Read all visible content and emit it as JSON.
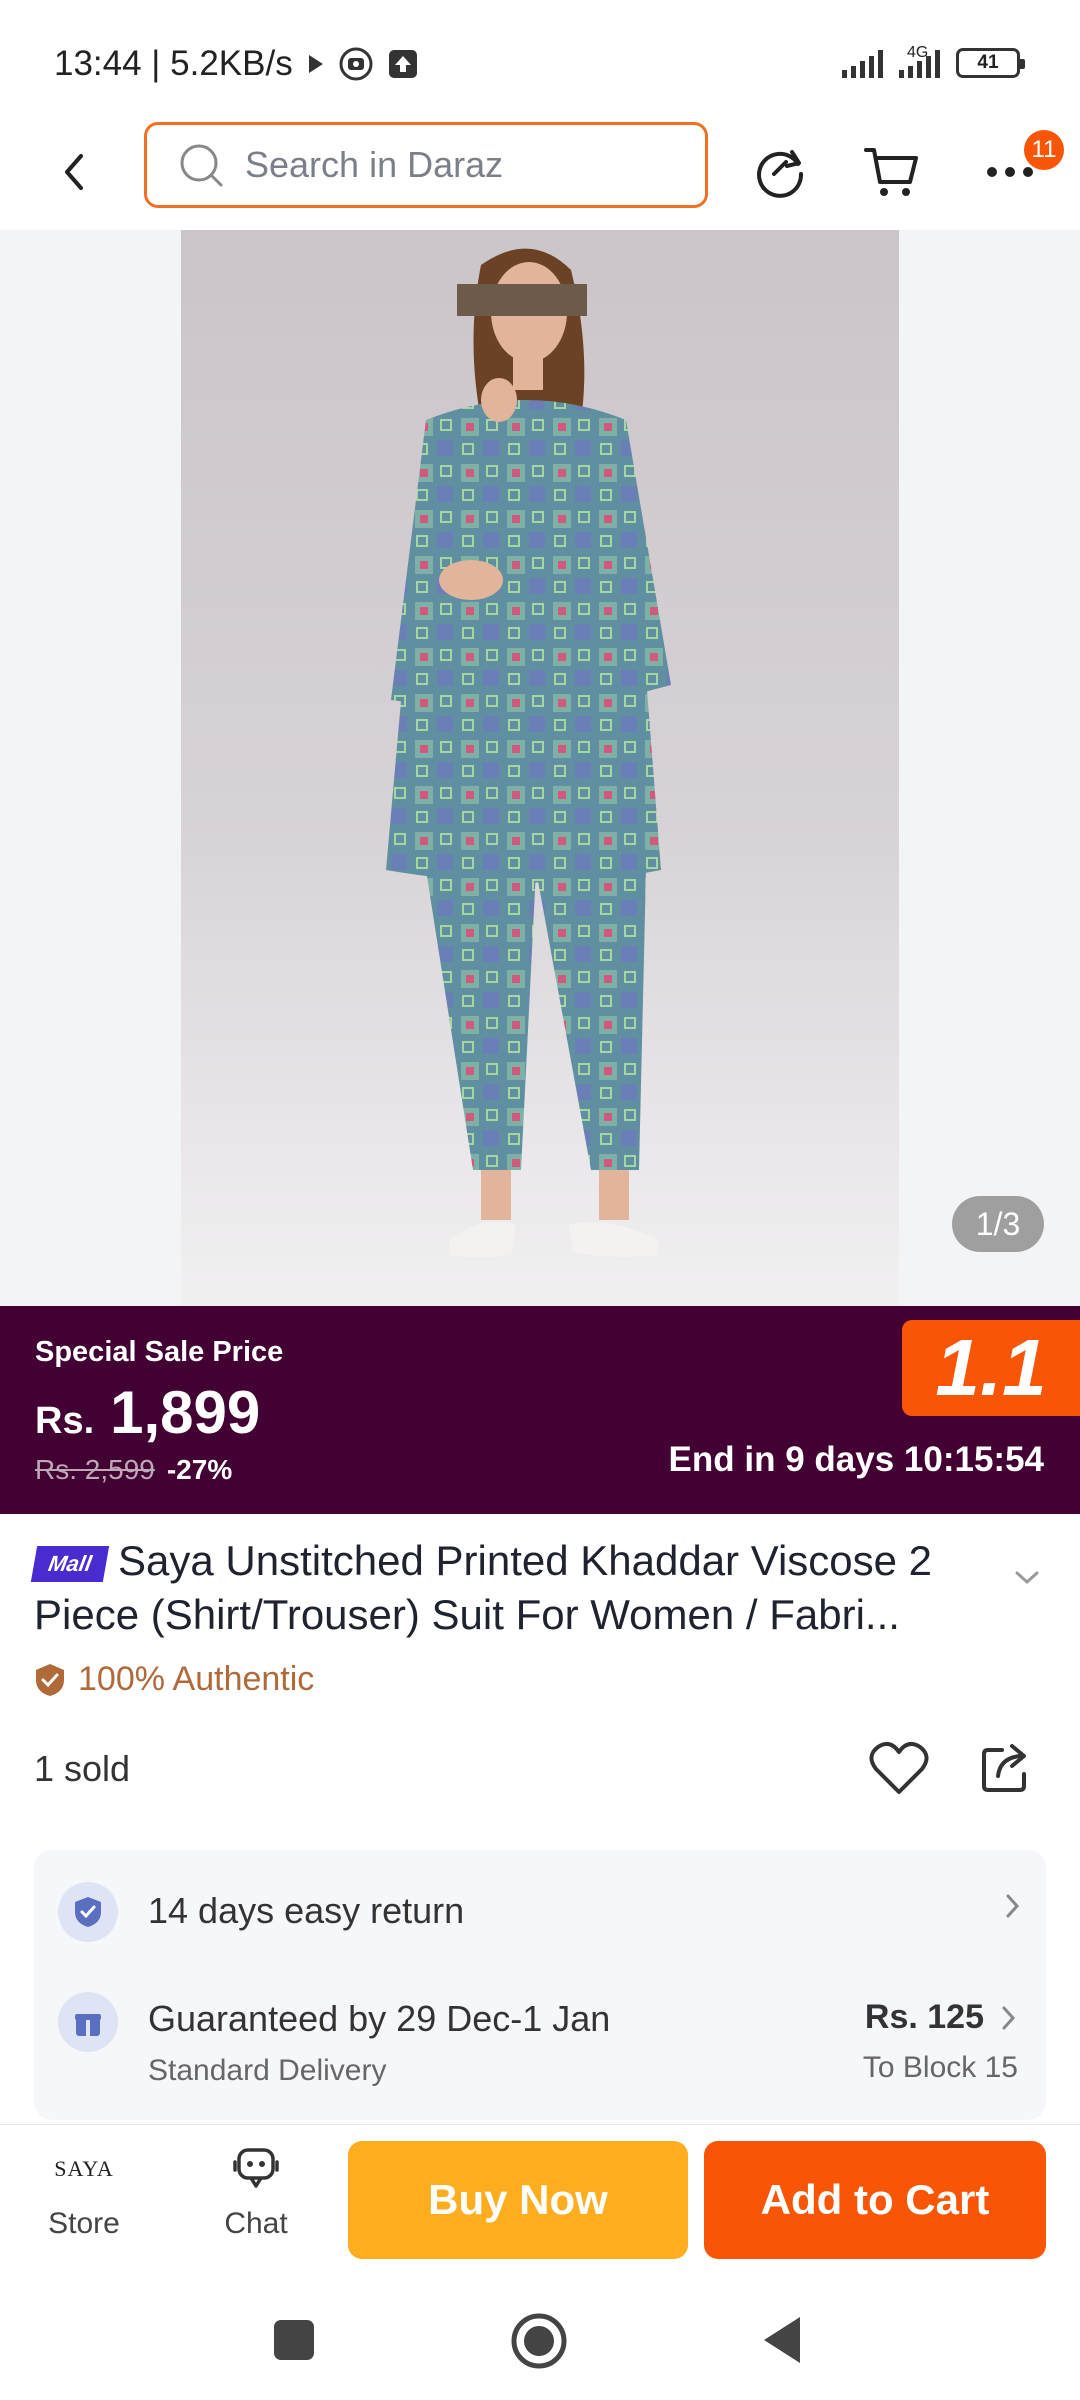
{
  "status_bar": {
    "time_speed": "13:44 | 5.2KB/s",
    "network": "4G",
    "battery": "41"
  },
  "header": {
    "search_placeholder": "Search in Daraz",
    "menu_badge": "11"
  },
  "gallery": {
    "counter": "1/3"
  },
  "sale": {
    "label": "Special Sale Price",
    "currency": "Rs.",
    "price": "1,899",
    "old_price": "Rs. 2,599",
    "discount": "-27%",
    "campaign_logo": "1.1",
    "countdown": "End in 9 days 10:15:54"
  },
  "product": {
    "mall_badge": "Mall",
    "title": "Saya Unstitched Printed Khaddar Viscose 2 Piece (Shirt/Trouser) Suit For Women / Fabri...",
    "authentic": "100% Authentic",
    "sold": "1 sold"
  },
  "services": {
    "returns": "14 days easy return",
    "delivery_title": "Guaranteed by 29 Dec-1 Jan",
    "delivery_type": "Standard Delivery",
    "delivery_price": "Rs. 125",
    "delivery_location": "To Block 15"
  },
  "bottom_bar": {
    "store_logo": "SAYA",
    "store_label": "Store",
    "chat_label": "Chat",
    "buy_now": "Buy Now",
    "add_to_cart": "Add to Cart"
  },
  "colors": {
    "brand_orange": "#f85606",
    "buy_yellow": "#fdad1e",
    "sale_purple": "#420033",
    "mall_blue": "#4a2bcf"
  }
}
